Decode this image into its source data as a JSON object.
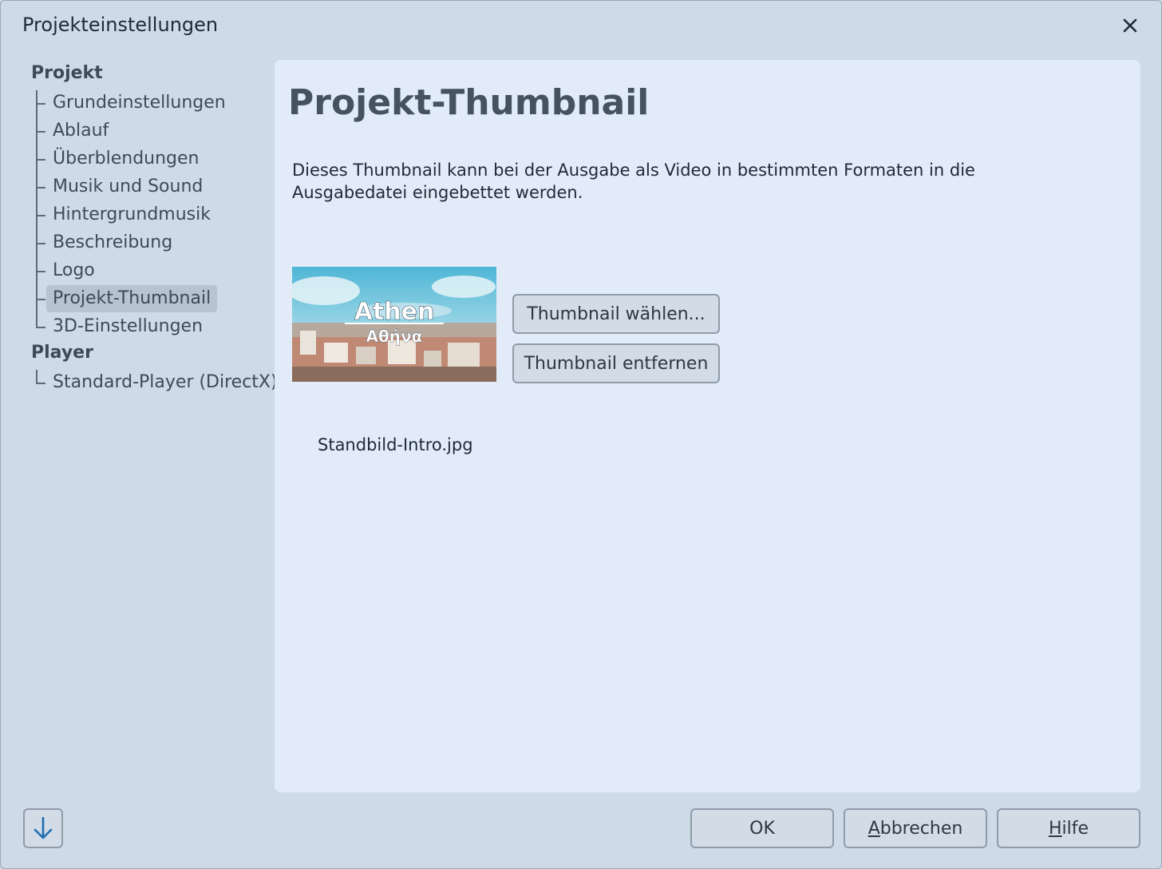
{
  "window": {
    "title": "Projekteinstellungen"
  },
  "sidebar": {
    "groups": [
      {
        "label": "Projekt",
        "items": [
          {
            "label": "Grundeinstellungen",
            "selected": false
          },
          {
            "label": "Ablauf",
            "selected": false
          },
          {
            "label": "Überblendungen",
            "selected": false
          },
          {
            "label": "Musik und Sound",
            "selected": false
          },
          {
            "label": "Hintergrundmusik",
            "selected": false
          },
          {
            "label": "Beschreibung",
            "selected": false
          },
          {
            "label": "Logo",
            "selected": false
          },
          {
            "label": "Projekt-Thumbnail",
            "selected": true
          },
          {
            "label": "3D-Einstellungen",
            "selected": false
          }
        ]
      },
      {
        "label": "Player",
        "items": [
          {
            "label": "Standard-Player (DirectX)",
            "selected": false
          }
        ]
      }
    ]
  },
  "main": {
    "title": "Projekt-Thumbnail",
    "description": "Dieses Thumbnail kann bei der Ausgabe als Video in bestimmten Formaten in die Ausgabedatei eingebettet werden.",
    "thumbnail": {
      "title": "Athen",
      "subtitle": "Αθήνα"
    },
    "choose_button": "Thumbnail wählen...",
    "remove_button": "Thumbnail entfernen",
    "filename": "Standbild-Intro.jpg"
  },
  "footer": {
    "ok": "OK",
    "cancel": {
      "accel": "A",
      "rest": "bbrechen"
    },
    "help": {
      "accel": "H",
      "rest": "ilfe"
    }
  },
  "colors": {
    "accent": "#1f6fb2",
    "panel": "#e2ecf8",
    "window": "#cfdae7",
    "selection": "#b7c3d1"
  }
}
